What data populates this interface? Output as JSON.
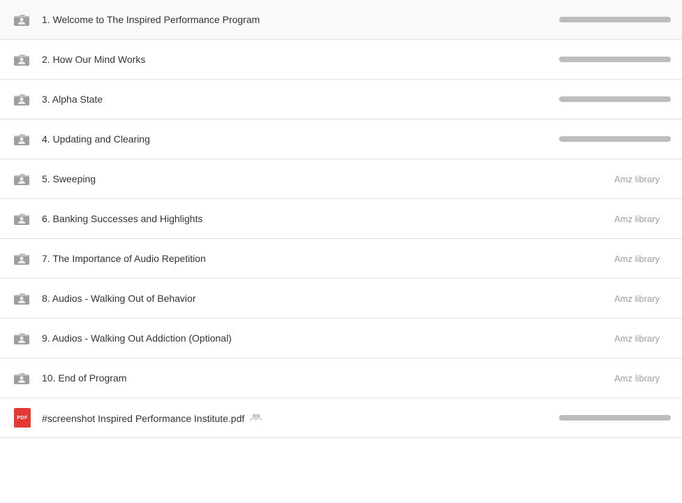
{
  "items": [
    {
      "id": 1,
      "number": "1.",
      "title": "Welcome to The Inspired Performance Program",
      "icon_type": "folder",
      "badge": null,
      "has_progress": true
    },
    {
      "id": 2,
      "number": "2.",
      "title": "How Our Mind Works",
      "icon_type": "folder",
      "badge": null,
      "has_progress": true
    },
    {
      "id": 3,
      "number": "3.",
      "title": " Alpha State",
      "icon_type": "folder",
      "badge": null,
      "has_progress": true
    },
    {
      "id": 4,
      "number": "4.",
      "title": "Updating and Clearing",
      "icon_type": "folder",
      "badge": null,
      "has_progress": true
    },
    {
      "id": 5,
      "number": "5.",
      "title": "Sweeping",
      "icon_type": "folder",
      "badge": "Amz library",
      "has_progress": false
    },
    {
      "id": 6,
      "number": "6.",
      "title": "Banking Successes and Highlights",
      "icon_type": "folder",
      "badge": "Amz library",
      "has_progress": false
    },
    {
      "id": 7,
      "number": "7.",
      "title": "The Importance of Audio Repetition",
      "icon_type": "folder",
      "badge": "Amz library",
      "has_progress": false
    },
    {
      "id": 8,
      "number": "8.",
      "title": "Audios - Walking Out of Behavior",
      "icon_type": "folder",
      "badge": "Amz library",
      "has_progress": false
    },
    {
      "id": 9,
      "number": "9.",
      "title": "Audios - Walking Out Addiction (Optional)",
      "icon_type": "folder",
      "badge": "Amz library",
      "has_progress": false
    },
    {
      "id": 10,
      "number": "10.",
      "title": " End of Program",
      "icon_type": "folder",
      "badge": "Amz library",
      "has_progress": false
    },
    {
      "id": 11,
      "number": "",
      "title": "#screenshot Inspired Performance Institute.pdf",
      "icon_type": "pdf",
      "badge": null,
      "has_progress": true,
      "has_group_icon": true
    }
  ],
  "pdf_label": "PDF",
  "amz_library": "Amz library"
}
